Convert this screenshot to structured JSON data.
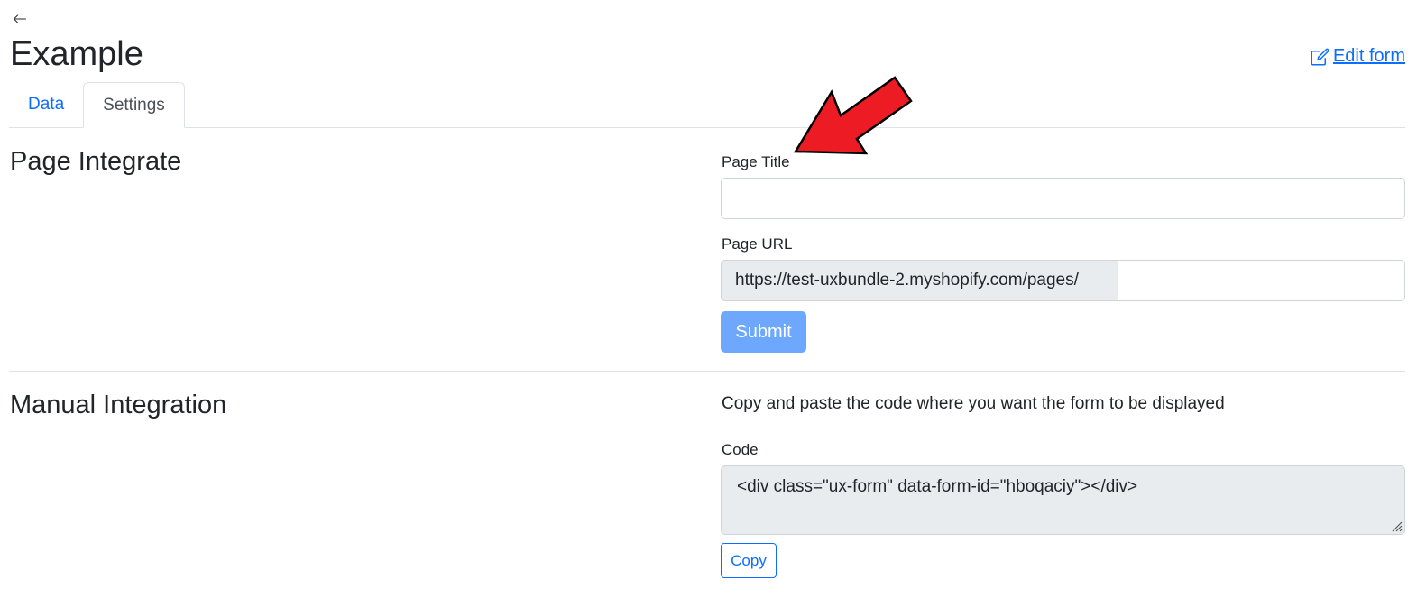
{
  "header": {
    "back_icon": "arrow-left-icon",
    "title": "Example",
    "edit_form_label": "Edit form",
    "edit_icon": "pencil-square-icon"
  },
  "tabs": [
    {
      "label": "Data",
      "active": false
    },
    {
      "label": "Settings",
      "active": true
    }
  ],
  "page_integrate": {
    "section_title": "Page Integrate",
    "page_title_label": "Page Title",
    "page_title_value": "",
    "page_url_label": "Page URL",
    "page_url_prefix": "https://test-uxbundle-2.myshopify.com/pages/",
    "page_url_value": "",
    "submit_label": "Submit"
  },
  "manual_integration": {
    "section_title": "Manual Integration",
    "help_text": "Copy and paste the code where you want the form to be displayed",
    "code_label": "Code",
    "code_value": "<div class=\"ux-form\" data-form-id=\"hboqaciy\"></div>",
    "copy_label": "Copy"
  },
  "annotation": {
    "arrow_color": "#ed1c24",
    "arrow_icon": "red-arrow-icon"
  },
  "colors": {
    "link": "#0d6efd",
    "submit_disabled": "#6ea8fe",
    "readonly_bg": "#e9ecef"
  }
}
